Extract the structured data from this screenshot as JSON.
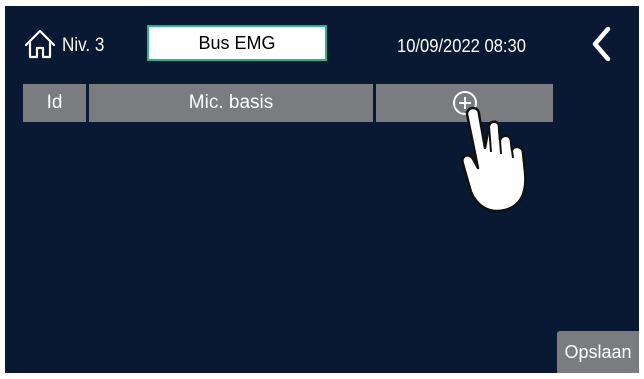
{
  "header": {
    "home_icon": "home-icon",
    "level_label": "Niv. 3",
    "bus_label": "Bus EMG",
    "bus_box_border_color": "#2bb585",
    "datetime": "10/09/2022 08:30",
    "back_icon": "chevron-left-icon"
  },
  "table": {
    "columns": [
      "Id",
      "Mic. basis"
    ],
    "add_icon": "plus-circle-icon",
    "rows": []
  },
  "overlay": {
    "pointer_icon": "hand-pointer-icon"
  },
  "footer": {
    "save_label": "Opslaan"
  },
  "colors": {
    "background": "#091833",
    "header_cell": "#7a7c80",
    "accent": "#2bb585"
  }
}
